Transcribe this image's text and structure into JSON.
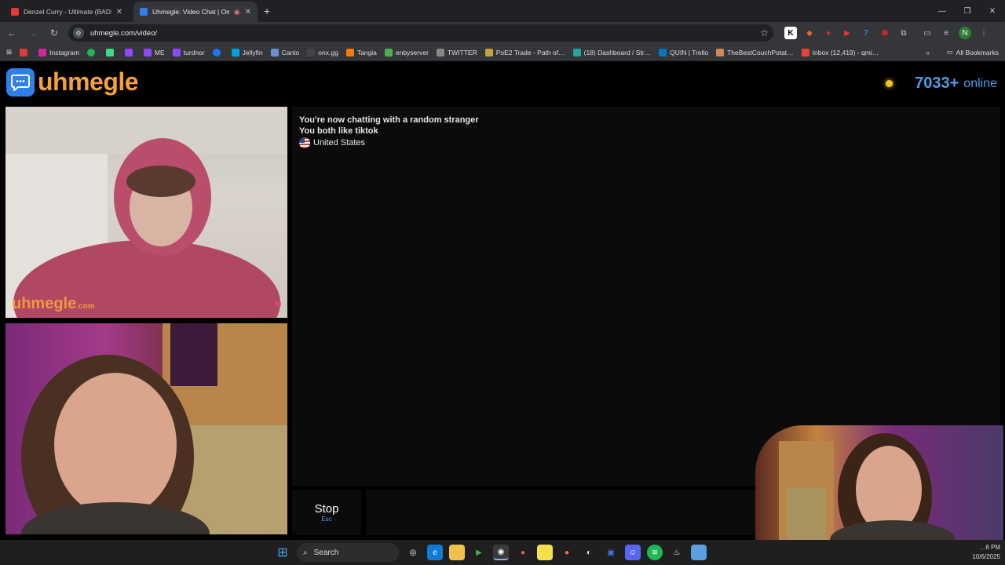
{
  "browser": {
    "tabs": [
      {
        "title": "Denzel Curry - Ultimate (BADB…",
        "fav_color": "#e53935"
      },
      {
        "title": "Uhmegle: Video Chat | Om…",
        "fav_color": "#2f80ed"
      }
    ],
    "url": "uhmegle.com/video/",
    "bookmarks": [
      {
        "label": "",
        "color": "#e53935"
      },
      {
        "label": "Instagram",
        "color": "#d6249f"
      },
      {
        "label": "",
        "color": "#1db954"
      },
      {
        "label": "",
        "color": "#3ddc84"
      },
      {
        "label": "",
        "color": "#9146ff"
      },
      {
        "label": "ME",
        "color": "#9146ff"
      },
      {
        "label": "turdnor",
        "color": "#9146ff"
      },
      {
        "label": "",
        "color": "#1877f2"
      },
      {
        "label": "Jellyfin",
        "color": "#00a4dc"
      },
      {
        "label": "Canto",
        "color": "#6a8dd8"
      },
      {
        "label": "onx.gg",
        "color": "#444"
      },
      {
        "label": "Tangia",
        "color": "#f57c00"
      },
      {
        "label": "enbyserver",
        "color": "#4caf50"
      },
      {
        "label": "TWITTER",
        "color": "#888"
      },
      {
        "label": "PoE2 Trade - Path of…",
        "color": "#c9a13a"
      },
      {
        "label": "(18) Dashboard / Str…",
        "color": "#26a69a"
      },
      {
        "label": "QUIN | Trello",
        "color": "#0079bf"
      },
      {
        "label": "TheBestCouchPotat…",
        "color": "#d1885a"
      },
      {
        "label": "Inbox (12,419) - qmi…",
        "color": "#ea4335"
      }
    ],
    "all_bookmarks_label": "All Bookmarks"
  },
  "site": {
    "logo_text": "uhmegle",
    "online_count": "7033+",
    "online_label": "online",
    "watermark_main": "uhmegle",
    "watermark_tld": ".com"
  },
  "chat": {
    "line1": "You're now chatting with a random stranger",
    "line2": "You both like tiktok",
    "country": "United States"
  },
  "controls": {
    "stop_label": "Stop",
    "stop_key": "Esc"
  },
  "taskbar": {
    "search_label": "Search",
    "time": "…6 PM",
    "date": "10/6/2025"
  }
}
